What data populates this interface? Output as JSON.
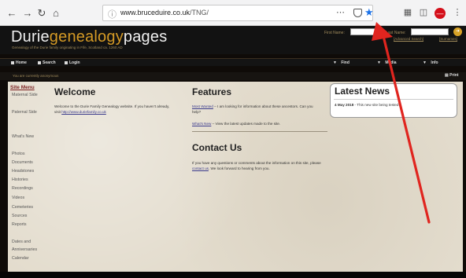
{
  "browser": {
    "url_host": "www.bruceduire.co.uk",
    "url_path": "/TNG/",
    "nav_icons": [
      "back-icon",
      "forward-icon",
      "reload-icon",
      "home-icon"
    ],
    "toolbar_icons": [
      "library-icon",
      "sidebar-icon",
      "stop-icon",
      "menu-icon"
    ]
  },
  "header": {
    "logo_main": "Durie",
    "logo_accent": "genealogy",
    "logo_tail": "pages",
    "tagline": "Genealogy of the Durie family originating in Fife, Scotland ca. 1260 AD",
    "first_name_label": "First Name:",
    "last_name_label": "Last Name:",
    "advanced_search": "[Advanced Search]",
    "surnames": "[Surnames]"
  },
  "mainnav": {
    "home": "Home",
    "search": "Search",
    "login": "Login",
    "find": "Find",
    "media": "Media",
    "info": "Info"
  },
  "status": {
    "text": "You are currently anonymous",
    "print": "Print"
  },
  "sidemenu": {
    "title": "Site Menu",
    "items": [
      "Maternal Side",
      "Paternal Side",
      "What's New",
      "Photos",
      "Documents",
      "Headstones",
      "Histories",
      "Recordings",
      "Videos",
      "Cemeteries",
      "Sources",
      "Reports",
      "Dates and",
      "Anniversaries",
      "Calendar"
    ]
  },
  "welcome": {
    "heading": "Welcome",
    "text": "Welcome to the Durie Family Genealogy website. If you haven't already, visit",
    "link": "http://www.duriefamily.co.uk"
  },
  "features": {
    "heading": "Features",
    "item1_link": "Most Wanted",
    "item1_text": " – I am looking for information about these ancestors. Can you help?",
    "item2_link": "What's New",
    "item2_text": " – View the latest updates made to the site."
  },
  "contact": {
    "heading": "Contact Us",
    "text_before": "If you have any questions or comments about the information on this site, please ",
    "link": "contact us",
    "text_after": ". We look forward to hearing from you."
  },
  "news": {
    "heading": "Latest News",
    "date": "4 May 2018",
    "text": " - This new site being tested"
  },
  "colors": {
    "accent": "#d59a25",
    "link": "#3a3a8c",
    "arrow": "#e0251f"
  }
}
